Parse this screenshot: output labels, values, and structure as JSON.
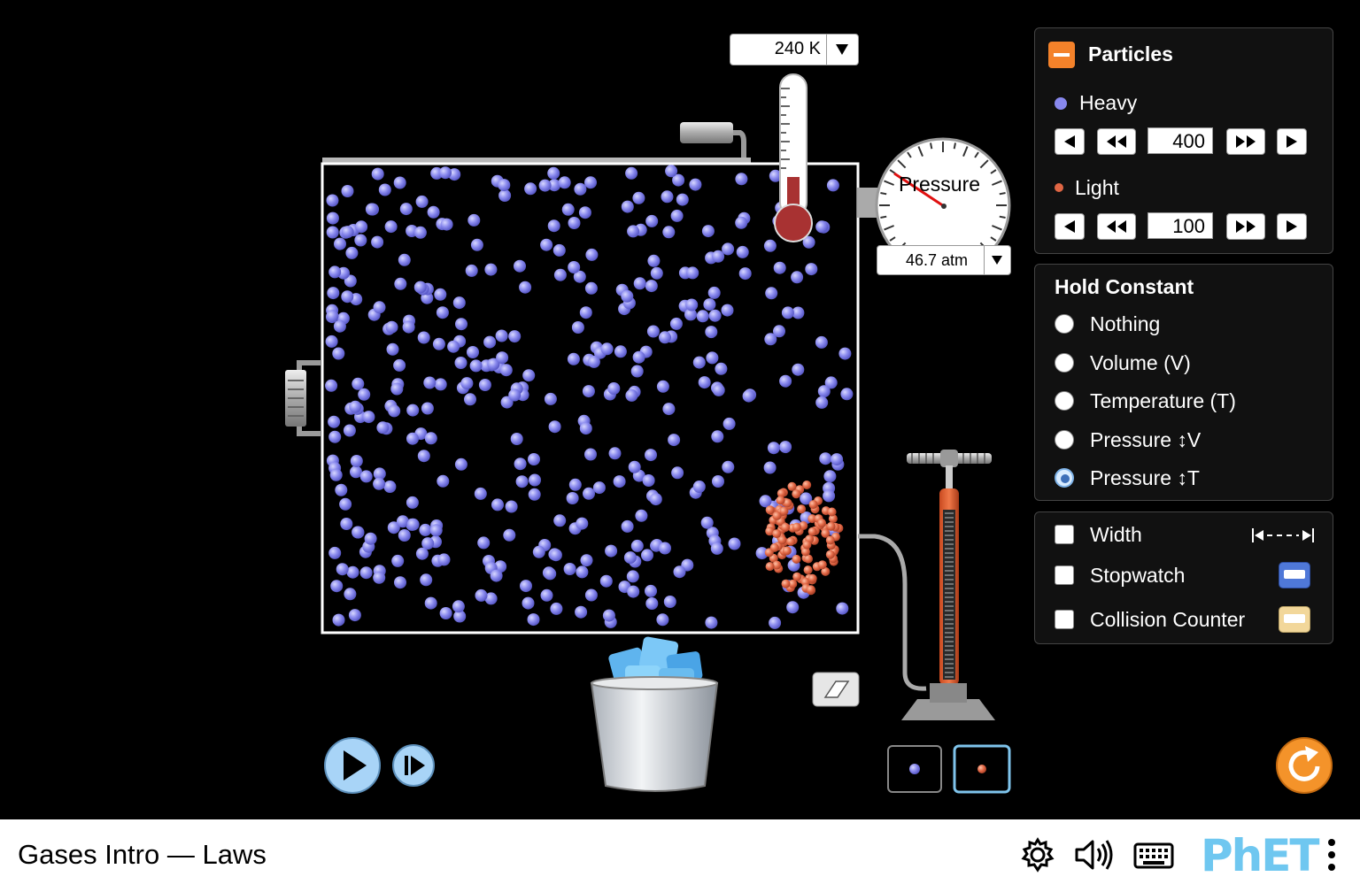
{
  "app": {
    "title": "Gases Intro — Laws",
    "logo_text": "PhET"
  },
  "thermometer": {
    "readout": "240 K"
  },
  "gauge": {
    "label": "Pressure",
    "readout": "46.7 atm"
  },
  "particles_panel": {
    "title": "Particles",
    "heavy": {
      "label": "Heavy",
      "value": "400",
      "color": "#8888ee"
    },
    "light": {
      "label": "Light",
      "value": "100",
      "color": "#e06644"
    }
  },
  "hold_constant": {
    "title": "Hold Constant",
    "options": [
      {
        "label": "Nothing",
        "selected": false
      },
      {
        "label": "Volume (V)",
        "selected": false
      },
      {
        "label": "Temperature (T)",
        "selected": false
      },
      {
        "label": "Pressure ↕V",
        "selected": false
      },
      {
        "label": "Pressure ↕T",
        "selected": true
      }
    ]
  },
  "tools_panel": {
    "width": {
      "label": "Width",
      "checked": false
    },
    "stopwatch": {
      "label": "Stopwatch",
      "checked": false
    },
    "collision_counter": {
      "label": "Collision Counter",
      "checked": false
    }
  },
  "colors": {
    "accent": "#f4822a",
    "panel_bg": "#111111",
    "heavy": "#8888ee",
    "light": "#e06644"
  }
}
